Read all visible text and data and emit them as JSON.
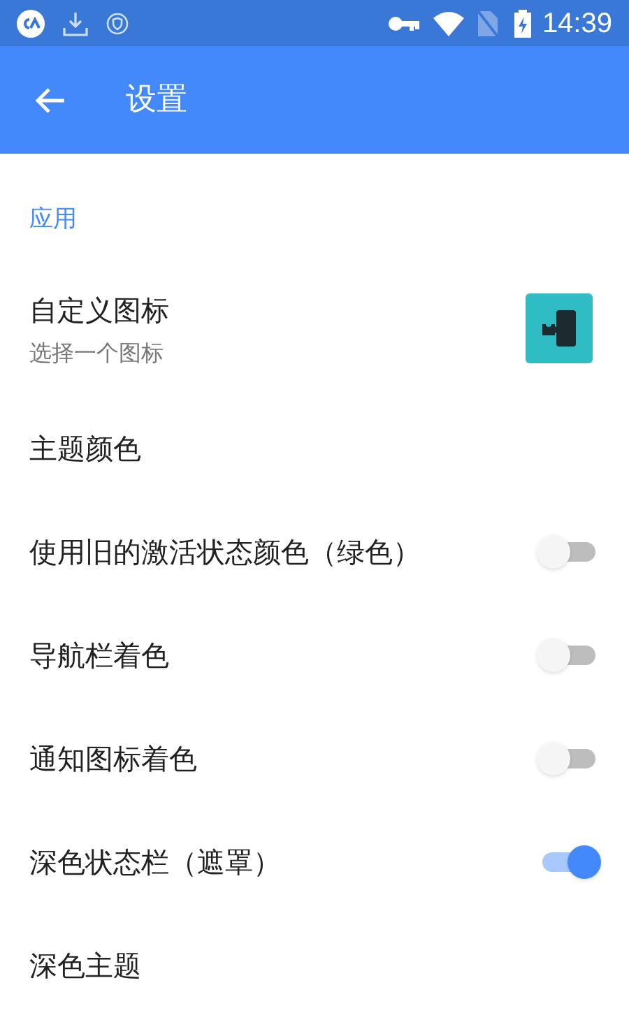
{
  "status_bar": {
    "time": "14:39"
  },
  "app_bar": {
    "title": "设置"
  },
  "section": {
    "title": "应用"
  },
  "items": [
    {
      "kind": "icon",
      "title": "自定义图标",
      "subtitle": "选择一个图标"
    },
    {
      "kind": "plain",
      "title": "主题颜色"
    },
    {
      "kind": "switch",
      "title": "使用旧的激活状态颜色（绿色）",
      "on": false
    },
    {
      "kind": "switch",
      "title": "导航栏着色",
      "on": false
    },
    {
      "kind": "switch",
      "title": "通知图标着色",
      "on": false
    },
    {
      "kind": "switch",
      "title": "深色状态栏（遮罩）",
      "on": true
    },
    {
      "kind": "plain",
      "title": "深色主题"
    }
  ]
}
